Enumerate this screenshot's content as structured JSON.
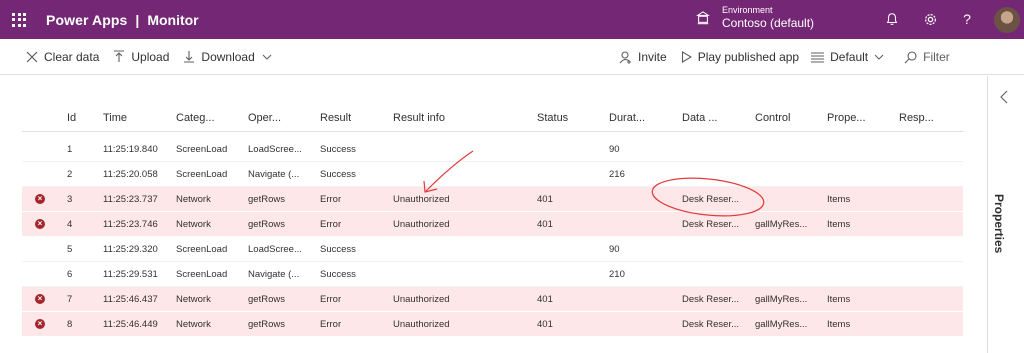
{
  "header": {
    "app_title": "Power Apps",
    "separator": "|",
    "section": "Monitor",
    "environment_label": "Environment",
    "environment_name": "Contoso (default)"
  },
  "toolbar": {
    "clear_data": "Clear data",
    "upload": "Upload",
    "download": "Download",
    "invite": "Invite",
    "play_published_app": "Play published app",
    "view": "Default",
    "filter": "Filter"
  },
  "side_panel": {
    "title": "Properties"
  },
  "table": {
    "columns": [
      "Id",
      "Time",
      "Categ...",
      "Oper...",
      "Result",
      "Result info",
      "Status",
      "Durat...",
      "Data ...",
      "Control",
      "Prope...",
      "Resp..."
    ],
    "rows": [
      {
        "id": "1",
        "time": "11:25:19.840",
        "category": "ScreenLoad",
        "operation": "LoadScree...",
        "result": "Success",
        "result_info": "",
        "status": "",
        "duration": "90",
        "data": "",
        "control": "",
        "property": "",
        "response": "",
        "error": false
      },
      {
        "id": "2",
        "time": "11:25:20.058",
        "category": "ScreenLoad",
        "operation": "Navigate (...",
        "result": "Success",
        "result_info": "",
        "status": "",
        "duration": "216",
        "data": "",
        "control": "",
        "property": "",
        "response": "",
        "error": false
      },
      {
        "id": "3",
        "time": "11:25:23.737",
        "category": "Network",
        "operation": "getRows",
        "result": "Error",
        "result_info": "Unauthorized",
        "status": "401",
        "duration": "",
        "data": "Desk Reser...",
        "control": "",
        "property": "Items",
        "response": "",
        "error": true
      },
      {
        "id": "4",
        "time": "11:25:23.746",
        "category": "Network",
        "operation": "getRows",
        "result": "Error",
        "result_info": "Unauthorized",
        "status": "401",
        "duration": "",
        "data": "Desk Reser...",
        "control": "gallMyRes...",
        "property": "Items",
        "response": "",
        "error": true
      },
      {
        "id": "5",
        "time": "11:25:29.320",
        "category": "ScreenLoad",
        "operation": "LoadScree...",
        "result": "Success",
        "result_info": "",
        "status": "",
        "duration": "90",
        "data": "",
        "control": "",
        "property": "",
        "response": "",
        "error": false
      },
      {
        "id": "6",
        "time": "11:25:29.531",
        "category": "ScreenLoad",
        "operation": "Navigate (...",
        "result": "Success",
        "result_info": "",
        "status": "",
        "duration": "210",
        "data": "",
        "control": "",
        "property": "",
        "response": "",
        "error": false
      },
      {
        "id": "7",
        "time": "11:25:46.437",
        "category": "Network",
        "operation": "getRows",
        "result": "Error",
        "result_info": "Unauthorized",
        "status": "401",
        "duration": "",
        "data": "Desk Reser...",
        "control": "gallMyRes...",
        "property": "Items",
        "response": "",
        "error": true
      },
      {
        "id": "8",
        "time": "11:25:46.449",
        "category": "Network",
        "operation": "getRows",
        "result": "Error",
        "result_info": "Unauthorized",
        "status": "401",
        "duration": "",
        "data": "Desk Reser...",
        "control": "gallMyRes...",
        "property": "Items",
        "response": "",
        "error": true
      }
    ]
  },
  "colors": {
    "header_bg": "#742774",
    "error_row_bg": "#fde7e9",
    "error_icon": "#a4262c",
    "annotation": "#e03c3c"
  },
  "icons": {
    "waffle": "app-launcher-icon",
    "environment": "environment-icon",
    "bell": "notifications-icon",
    "settings": "gear-icon",
    "help": "help-icon"
  }
}
